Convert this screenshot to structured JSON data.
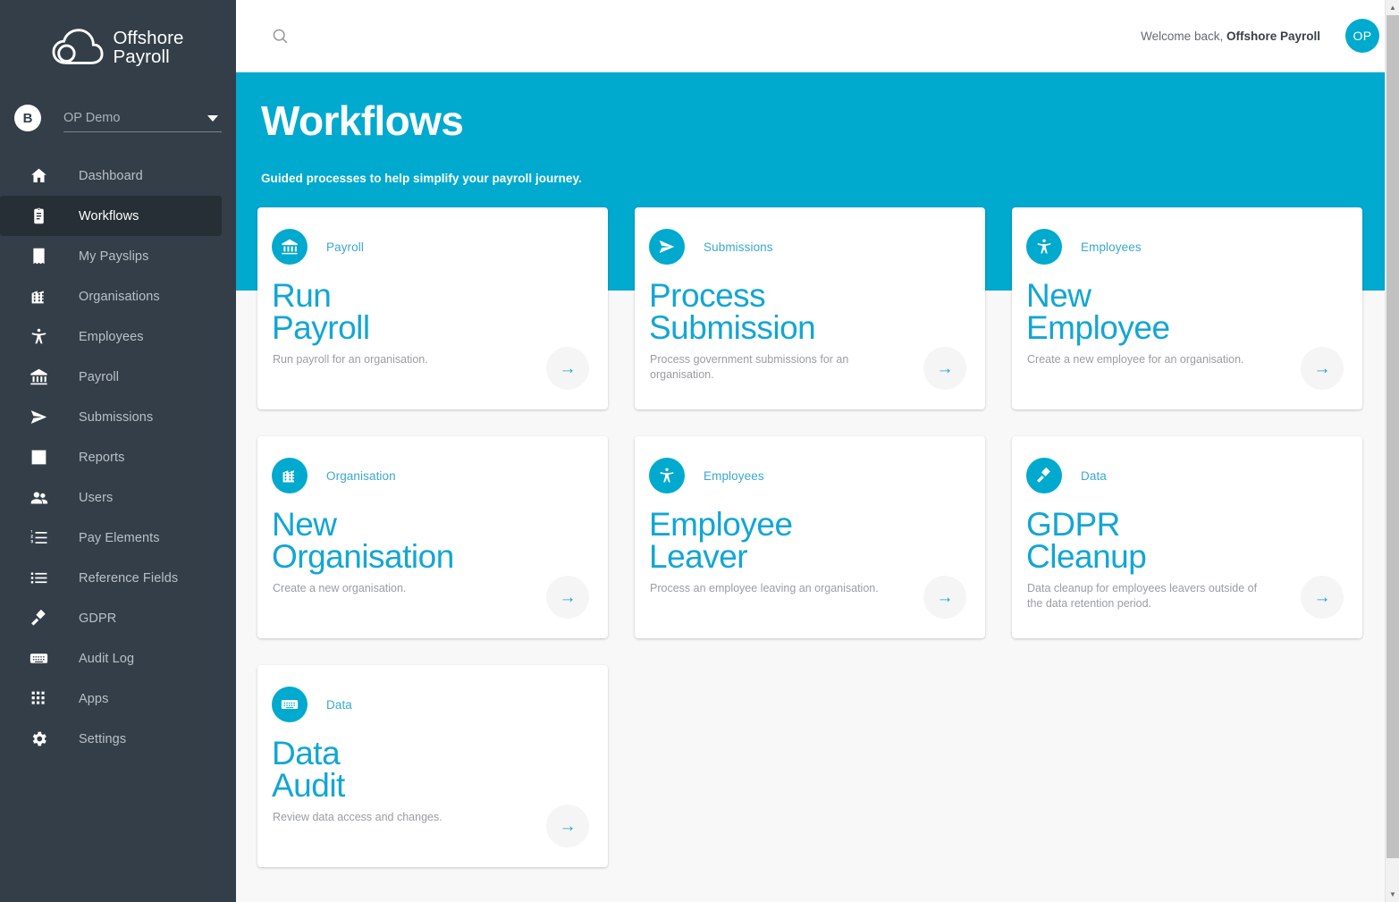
{
  "brand": {
    "logo_icon": "cloud-icon",
    "line1": "Offshore",
    "line2": "Payroll"
  },
  "sidebar": {
    "org_switcher": {
      "avatar_initial": "B",
      "selected": "OP Demo",
      "caret_icon": "chevron-down-icon"
    },
    "items": [
      {
        "label": "Dashboard",
        "icon": "home-icon",
        "active": false
      },
      {
        "label": "Workflows",
        "icon": "clipboard-icon",
        "active": true
      },
      {
        "label": "My Payslips",
        "icon": "receipt-icon",
        "active": false
      },
      {
        "label": "Organisations",
        "icon": "building-icon",
        "active": false
      },
      {
        "label": "Employees",
        "icon": "accessibility-icon",
        "active": false
      },
      {
        "label": "Payroll",
        "icon": "bank-icon",
        "active": false
      },
      {
        "label": "Submissions",
        "icon": "send-icon",
        "active": false
      },
      {
        "label": "Reports",
        "icon": "bar-chart-icon",
        "active": false
      },
      {
        "label": "Users",
        "icon": "people-icon",
        "active": false
      },
      {
        "label": "Pay Elements",
        "icon": "numbered-list-icon",
        "active": false
      },
      {
        "label": "Reference Fields",
        "icon": "list-icon",
        "active": false
      },
      {
        "label": "GDPR",
        "icon": "gavel-icon",
        "active": false
      },
      {
        "label": "Audit Log",
        "icon": "keyboard-icon",
        "active": false
      },
      {
        "label": "Apps",
        "icon": "grid-apps-icon",
        "active": false
      },
      {
        "label": "Settings",
        "icon": "gear-icon",
        "active": false
      }
    ]
  },
  "topbar": {
    "search_icon": "search-icon",
    "welcome_prefix": "Welcome back, ",
    "welcome_name": "Offshore Payroll",
    "avatar_initials": "OP"
  },
  "hero": {
    "title": "Workflows",
    "subtitle": "Guided processes to help simplify your payroll journey."
  },
  "colors": {
    "accent": "#00a9ce",
    "sidebar_bg": "#333e48",
    "sidebar_active_bg": "#262f36",
    "card_title": "#12a6d4",
    "page_bg": "#f8f8f8"
  },
  "cards": [
    {
      "category": "Payroll",
      "icon": "bank-icon",
      "title": "Run\nPayroll",
      "description": "Run payroll for an organisation.",
      "arrow_icon": "arrow-right-icon"
    },
    {
      "category": "Submissions",
      "icon": "send-icon",
      "title": "Process\nSubmission",
      "description": "Process government submissions for an organisation.",
      "arrow_icon": "arrow-right-icon"
    },
    {
      "category": "Employees",
      "icon": "accessibility-icon",
      "title": "New\nEmployee",
      "description": "Create a new employee for an organisation.",
      "arrow_icon": "arrow-right-icon"
    },
    {
      "category": "Organisation",
      "icon": "building-icon",
      "title": "New\nOrganisation",
      "description": "Create a new organisation.",
      "arrow_icon": "arrow-right-icon"
    },
    {
      "category": "Employees",
      "icon": "accessibility-icon",
      "title": "Employee\nLeaver",
      "description": "Process an employee leaving an organisation.",
      "arrow_icon": "arrow-right-icon"
    },
    {
      "category": "Data",
      "icon": "gavel-icon",
      "title": "GDPR\nCleanup",
      "description": "Data cleanup for employees leavers outside of the data retention period.",
      "arrow_icon": "arrow-right-icon"
    },
    {
      "category": "Data",
      "icon": "keyboard-icon",
      "title": "Data\nAudit",
      "description": "Review data access and changes.",
      "arrow_icon": "arrow-right-icon"
    }
  ],
  "scrollbar": {
    "up_arrow_icon": "scroll-up-icon",
    "down_arrow_icon": "scroll-down-icon"
  }
}
